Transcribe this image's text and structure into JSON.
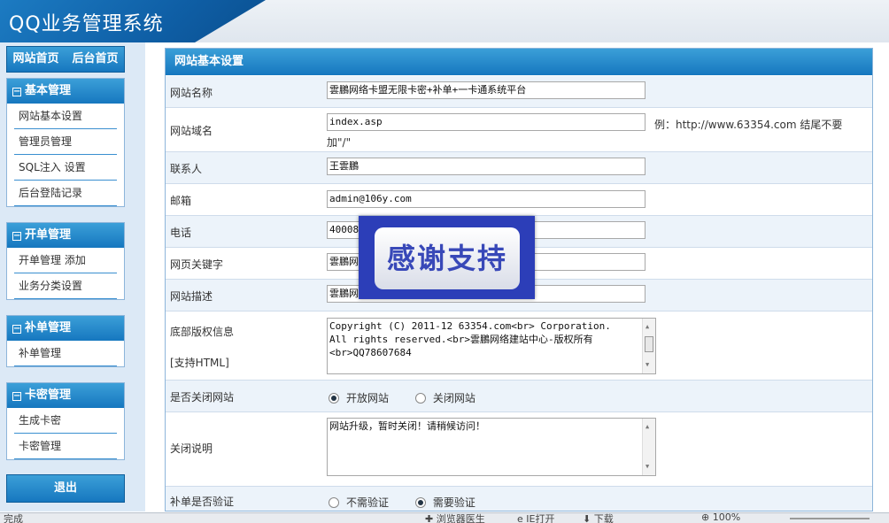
{
  "header": {
    "title": "QQ业务管理系统"
  },
  "sidebar": {
    "top_nav": {
      "home": "网站首页",
      "admin_home": "后台首页"
    },
    "groups": [
      {
        "title": "基本管理",
        "items": [
          "网站基本设置",
          "管理员管理",
          "SQL注入 设置",
          "后台登陆记录"
        ]
      },
      {
        "title": "开单管理",
        "items": [
          "开单管理 添加",
          "业务分类设置"
        ]
      },
      {
        "title": "补单管理",
        "items": [
          "补单管理"
        ]
      },
      {
        "title": "卡密管理",
        "items": [
          "生成卡密",
          "卡密管理"
        ]
      }
    ],
    "exit_label": "退出"
  },
  "main": {
    "title": "网站基本设置",
    "fields": {
      "site_name": {
        "label": "网站名称",
        "value": "雲鵬网络卡盟无限卡密+补单+一卡通系统平台"
      },
      "site_domain": {
        "label": "网站域名",
        "value": "index.asp",
        "hint": "例：http://www.63354.com 结尾不要",
        "hint2": "加\"/\""
      },
      "contact": {
        "label": "联系人",
        "value": "王雲鵬"
      },
      "email": {
        "label": "邮箱",
        "value": "admin@106y.com"
      },
      "phone": {
        "label": "电话",
        "value": "40008"
      },
      "keywords": {
        "label": "网页关键字",
        "value": "雲鵬网"
      },
      "description": {
        "label": "网站描述",
        "value": "雲鵬网"
      },
      "copyright": {
        "label": "底部版权信息",
        "label2": "[支持HTML]",
        "lines": [
          "Copyright (C) 2011-12 63354.com<br> Corporation.",
          "All rights reserved.<br>雲鵬网络建站中心-版权所有",
          "<br>QQ78607684"
        ]
      },
      "site_closed": {
        "label": "是否关闭网站",
        "options": [
          "开放网站",
          "关闭网站"
        ],
        "selected": 0
      },
      "close_note": {
        "label": "关闭说明",
        "value": "网站升级，暂时关闭！请稍候访问！"
      },
      "order_verify": {
        "label": "补单是否验证",
        "options": [
          "不需验证",
          "需要验证"
        ],
        "selected": 1
      }
    }
  },
  "overlay": {
    "text": "感谢支持"
  },
  "statusbar": {
    "left": "完成",
    "items": [
      "浏览器医生",
      "IE打开",
      "下载",
      "100%"
    ]
  }
}
